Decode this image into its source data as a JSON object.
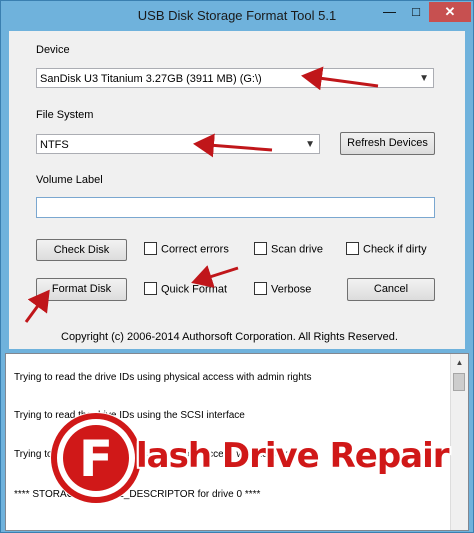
{
  "window": {
    "title": "USB Disk Storage Format Tool 5.1",
    "minimize_glyph": "—",
    "maximize_glyph": "□",
    "close_glyph": "✕"
  },
  "device": {
    "label": "Device",
    "selected": "SanDisk U3 Titanium 3.27GB (3911 MB)  (G:\\)"
  },
  "file_system": {
    "label": "File System",
    "selected": "NTFS"
  },
  "refresh_button": "Refresh Devices",
  "volume_label": {
    "label": "Volume Label",
    "value": ""
  },
  "buttons": {
    "check_disk": "Check Disk",
    "format_disk": "Format Disk",
    "cancel": "Cancel"
  },
  "checkboxes": {
    "correct_errors": "Correct errors",
    "scan_drive": "Scan drive",
    "check_if_dirty": "Check if dirty",
    "quick_format": "Quick Format",
    "verbose": "Verbose"
  },
  "copyright": "Copyright (c) 2006-2014 Authorsoft Corporation. All Rights Reserved.",
  "log_lines": [
    "Trying to read the drive IDs using physical access with admin rights",
    "Trying to read the drive IDs using the SCSI interface",
    "Trying to read the drive IDs using physical access with zero rights",
    "**** STORAGE_DEVICE_DESCRIPTOR for drive 0 ****"
  ],
  "watermark": {
    "logo_letter": "F",
    "text": "lash Drive Repair"
  },
  "colors": {
    "title_bar": "#6fb2dc",
    "close_button": "#c75050",
    "annotation_arrow": "#c0161a",
    "watermark_red": "#d01818"
  }
}
